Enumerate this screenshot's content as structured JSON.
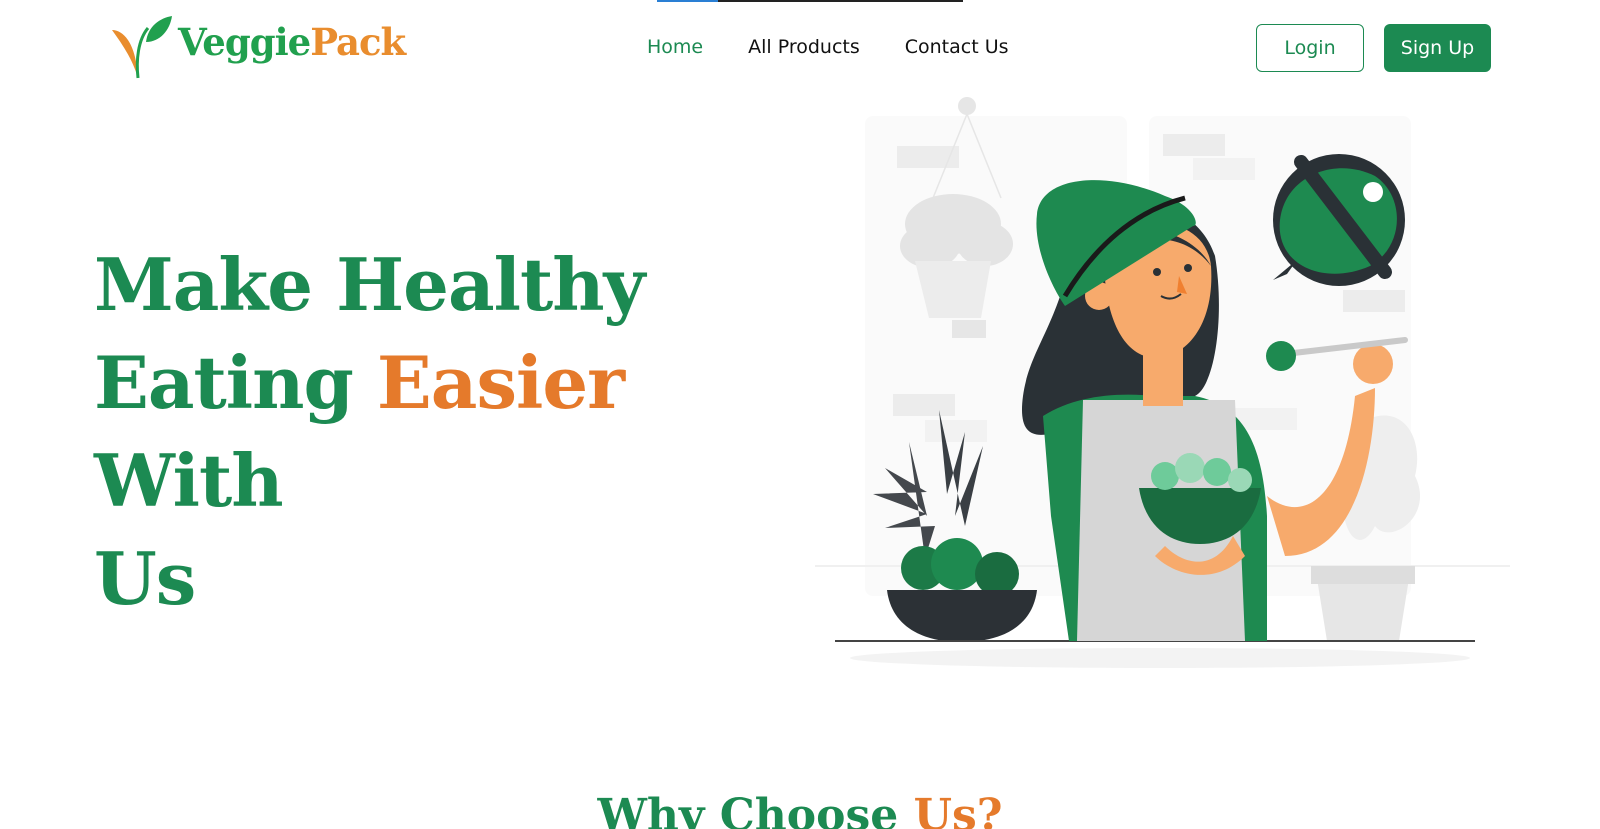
{
  "brand": {
    "part1": "Veggie",
    "part2": "Pack"
  },
  "nav": {
    "items": [
      {
        "label": "Home",
        "active": true
      },
      {
        "label": "All Products",
        "active": false
      },
      {
        "label": "Contact Us",
        "active": false
      }
    ]
  },
  "auth": {
    "login_label": "Login",
    "signup_label": "Sign Up"
  },
  "hero": {
    "line1": "Make Healthy",
    "line2a": "Eating",
    "line2_accent": "Easier",
    "line2b": "With",
    "line3": "Us"
  },
  "section": {
    "title_main": "Why Choose",
    "title_accent": "Us?"
  },
  "colors": {
    "primary": "#1c8a52",
    "accent": "#e57a2b",
    "logo_green": "#21a04e",
    "logo_orange": "#e98d2e"
  },
  "icons": [
    "leaf-logo-icon",
    "no-meat-icon"
  ]
}
